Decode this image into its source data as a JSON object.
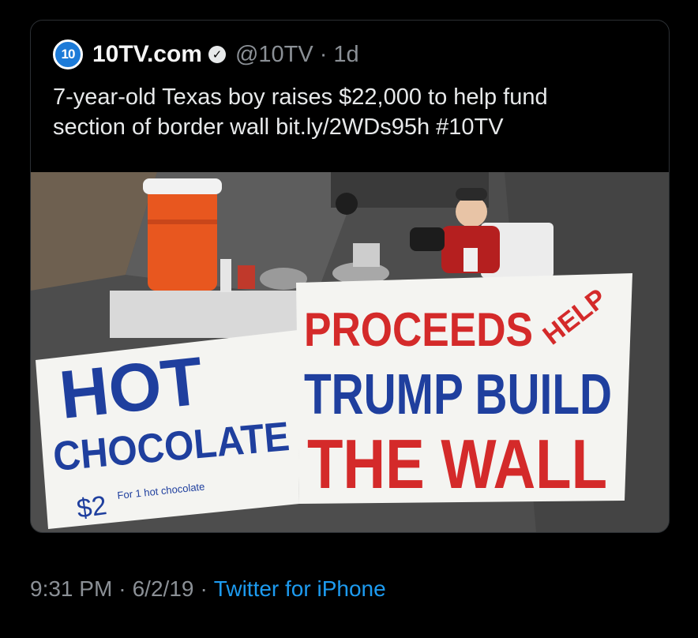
{
  "tweet": {
    "avatar_text": "10",
    "display_name": "10TV.com",
    "verified_icon": "✓",
    "handle": "@10TV",
    "separator": "·",
    "age": "1d",
    "text_line1": "7-year-old Texas boy raises $22,000 to help fund",
    "text_line2": "section of border wall bit.ly/2WDs95h #10TV"
  },
  "photo": {
    "sign_left_line1": "HOT",
    "sign_left_line2": "CHOCOLATE",
    "sign_left_price": "$2",
    "sign_left_small": "For 1  hot  chocolate",
    "sign_right_line1": "PROCEEDS",
    "sign_right_help": "HELP",
    "sign_right_line2": "TRUMP BUILD",
    "sign_right_line3": "THE WALL",
    "colors": {
      "blue": "#1f3f9e",
      "red": "#d42a2a",
      "cooler": "#e8571f"
    }
  },
  "footer": {
    "time": "9:31 PM",
    "separator": "·",
    "date": "6/2/19",
    "source": "Twitter for iPhone"
  }
}
